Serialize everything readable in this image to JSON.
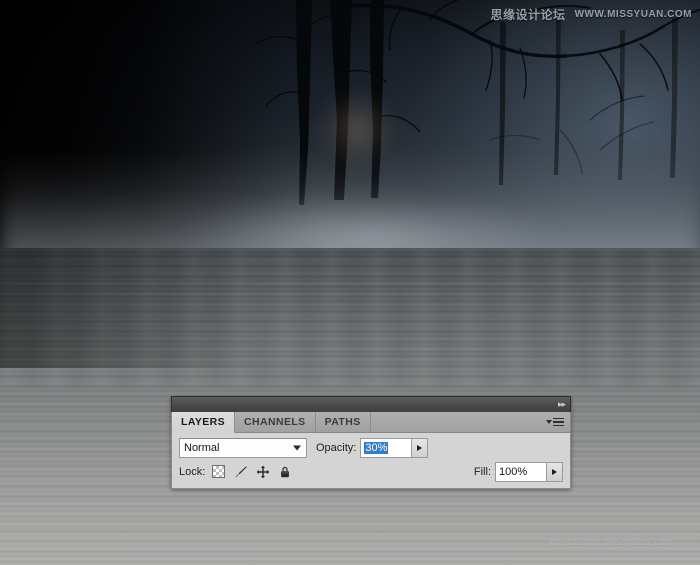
{
  "image": {
    "description": "dark-misty-forest-over-lake",
    "watermark_top_cn": "思缘设计论坛",
    "watermark_top_url": "WWW.MISSYUAN.COM",
    "watermark_bottom": "photoshop.missyuan.com"
  },
  "panel": {
    "collapse_icon": "double-chevron-right",
    "menu_icon": "panel-menu-icon",
    "tabs": [
      {
        "label": "LAYERS",
        "active": true
      },
      {
        "label": "CHANNELS",
        "active": false
      },
      {
        "label": "PATHS",
        "active": false
      }
    ],
    "blend_mode": {
      "value": "Normal",
      "chevron_icon": "chevron-down-icon"
    },
    "opacity": {
      "label": "Opacity:",
      "value": "30%",
      "selected": true,
      "arrow_icon": "slider-popup-arrow-icon"
    },
    "fill": {
      "label": "Fill:",
      "value": "100%",
      "selected": false,
      "arrow_icon": "slider-popup-arrow-icon"
    },
    "lock": {
      "label": "Lock:",
      "items": [
        {
          "icon": "transparent-pixels-checker-icon",
          "title": "Lock transparent pixels"
        },
        {
          "icon": "brush-icon",
          "title": "Lock image pixels"
        },
        {
          "icon": "move-arrows-icon",
          "title": "Lock position"
        },
        {
          "icon": "padlock-icon",
          "title": "Lock all"
        }
      ]
    }
  },
  "colors": {
    "panel_bg": "#d4d4d4",
    "tab_active_bg": "#dcdcdc",
    "titlebar": "#4c4c4c",
    "selection_blue": "#2f7fd1",
    "field_white": "#ffffff"
  }
}
